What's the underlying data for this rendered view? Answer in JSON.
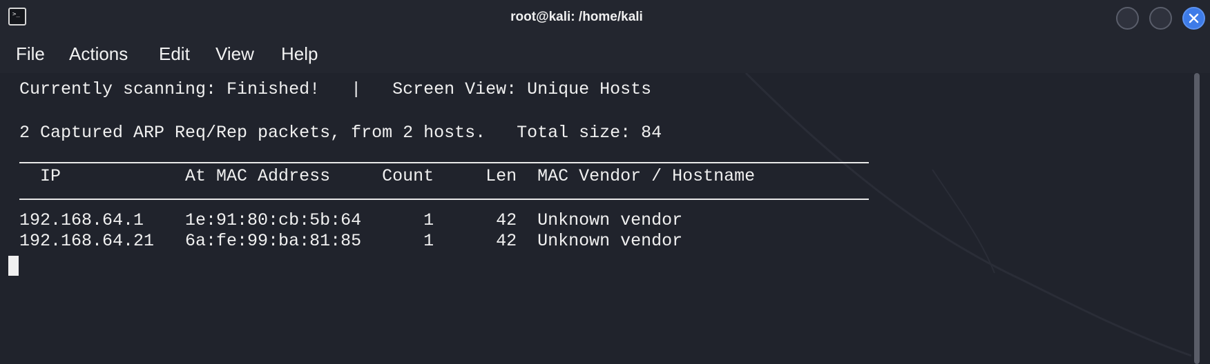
{
  "window": {
    "title": "root@kali: /home/kali",
    "app_icon_glyph": ">_",
    "icon": "terminal-icon"
  },
  "menu": {
    "items": [
      "File",
      "Actions",
      "Edit",
      "View",
      "Help"
    ]
  },
  "terminal": {
    "status_line": "Currently scanning: Finished!   |   Screen View: Unique Hosts",
    "summary_line": "2 Captured ARP Req/Rep packets, from 2 hosts.   Total size: 84",
    "header_line": "  IP            At MAC Address     Count     Len  MAC Vendor / Hostname",
    "rows": [
      "192.168.64.1    1e:91:80:cb:5b:64      1      42  Unknown vendor",
      "192.168.64.21   6a:fe:99:ba:81:85      1      42  Unknown vendor"
    ]
  },
  "colors": {
    "background": "#20232c",
    "text": "#f0f0f0",
    "close_button": "#3d7be8"
  }
}
